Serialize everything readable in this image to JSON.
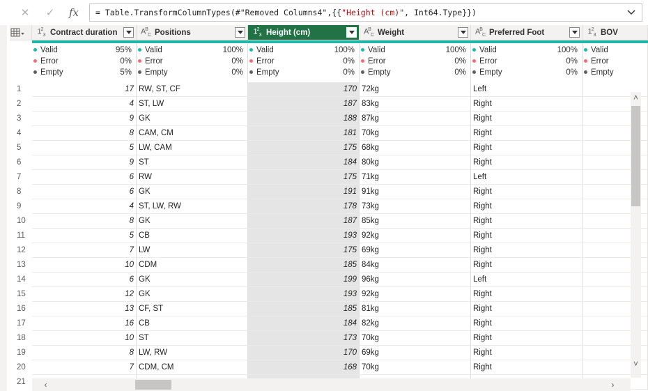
{
  "formula_bar": {
    "cancel_icon": "✕",
    "commit_icon": "✓",
    "fx_label": "fx",
    "formula_prefix": "= Table.TransformColumnTypes(#\"Removed Columns4\",{{",
    "formula_string": "\"Height (cm)\"",
    "formula_suffix": ", Int64.Type}})",
    "expand_icon": "⌵"
  },
  "columns": [
    {
      "type_icon": "1²₃",
      "name": "Contract duration",
      "kind": "num",
      "valid_pct": "95%",
      "error_pct": "0%",
      "empty_pct": "5%"
    },
    {
      "type_icon": "A^B_C",
      "name": "Positions",
      "kind": "txt",
      "valid_pct": "100%",
      "error_pct": "0%",
      "empty_pct": "0%"
    },
    {
      "type_icon": "1²₃",
      "name": "Height (cm)",
      "kind": "num",
      "valid_pct": "100%",
      "error_pct": "0%",
      "empty_pct": "0%",
      "selected": true
    },
    {
      "type_icon": "A^B_C",
      "name": "Weight",
      "kind": "txt",
      "valid_pct": "100%",
      "error_pct": "0%",
      "empty_pct": "0%"
    },
    {
      "type_icon": "A^B_C",
      "name": "Preferred Foot",
      "kind": "txt",
      "valid_pct": "100%",
      "error_pct": "0%",
      "empty_pct": "0%"
    },
    {
      "type_icon": "1²₃",
      "name": "BOV",
      "kind": "num",
      "valid_pct": "",
      "error_pct": "",
      "empty_pct": ""
    }
  ],
  "profile_labels": {
    "valid": "Valid",
    "error": "Error",
    "empty": "Empty"
  },
  "colors": {
    "valid": "#21b6a8",
    "error": "#f1707b",
    "empty": "#605e5c",
    "selected_header": "#217346"
  },
  "rows": [
    {
      "n": "1",
      "c": [
        "17",
        "RW, ST, CF",
        "170",
        "72kg",
        "Left",
        ""
      ]
    },
    {
      "n": "2",
      "c": [
        "4",
        "ST, LW",
        "187",
        "83kg",
        "Right",
        ""
      ]
    },
    {
      "n": "3",
      "c": [
        "9",
        "GK",
        "188",
        "87kg",
        "Right",
        ""
      ]
    },
    {
      "n": "4",
      "c": [
        "8",
        "CAM, CM",
        "181",
        "70kg",
        "Right",
        ""
      ]
    },
    {
      "n": "5",
      "c": [
        "5",
        "LW, CAM",
        "175",
        "68kg",
        "Right",
        ""
      ]
    },
    {
      "n": "6",
      "c": [
        "9",
        "ST",
        "184",
        "80kg",
        "Right",
        ""
      ]
    },
    {
      "n": "7",
      "c": [
        "6",
        "RW",
        "175",
        "71kg",
        "Left",
        ""
      ]
    },
    {
      "n": "8",
      "c": [
        "6",
        "GK",
        "191",
        "91kg",
        "Right",
        ""
      ]
    },
    {
      "n": "9",
      "c": [
        "4",
        "ST, LW, RW",
        "178",
        "73kg",
        "Right",
        ""
      ]
    },
    {
      "n": "10",
      "c": [
        "8",
        "GK",
        "187",
        "85kg",
        "Right",
        ""
      ]
    },
    {
      "n": "11",
      "c": [
        "5",
        "CB",
        "193",
        "92kg",
        "Right",
        ""
      ]
    },
    {
      "n": "12",
      "c": [
        "7",
        "LW",
        "175",
        "69kg",
        "Right",
        ""
      ]
    },
    {
      "n": "13",
      "c": [
        "10",
        "CDM",
        "185",
        "84kg",
        "Right",
        ""
      ]
    },
    {
      "n": "14",
      "c": [
        "6",
        "GK",
        "199",
        "96kg",
        "Left",
        ""
      ]
    },
    {
      "n": "15",
      "c": [
        "12",
        "GK",
        "193",
        "92kg",
        "Right",
        ""
      ]
    },
    {
      "n": "16",
      "c": [
        "13",
        "CF, ST",
        "185",
        "81kg",
        "Right",
        ""
      ]
    },
    {
      "n": "17",
      "c": [
        "16",
        "CB",
        "184",
        "82kg",
        "Right",
        ""
      ]
    },
    {
      "n": "18",
      "c": [
        "10",
        "ST",
        "173",
        "70kg",
        "Right",
        ""
      ]
    },
    {
      "n": "19",
      "c": [
        "8",
        "LW, RW",
        "170",
        "69kg",
        "Right",
        ""
      ]
    },
    {
      "n": "20",
      "c": [
        "7",
        "CDM, CM",
        "168",
        "70kg",
        "Right",
        ""
      ]
    },
    {
      "n": "21",
      "c": [
        "",
        "",
        "",
        "",
        "",
        ""
      ]
    }
  ],
  "scroll": {
    "up": "˄",
    "down": "˅",
    "left": "‹",
    "right": "›"
  }
}
